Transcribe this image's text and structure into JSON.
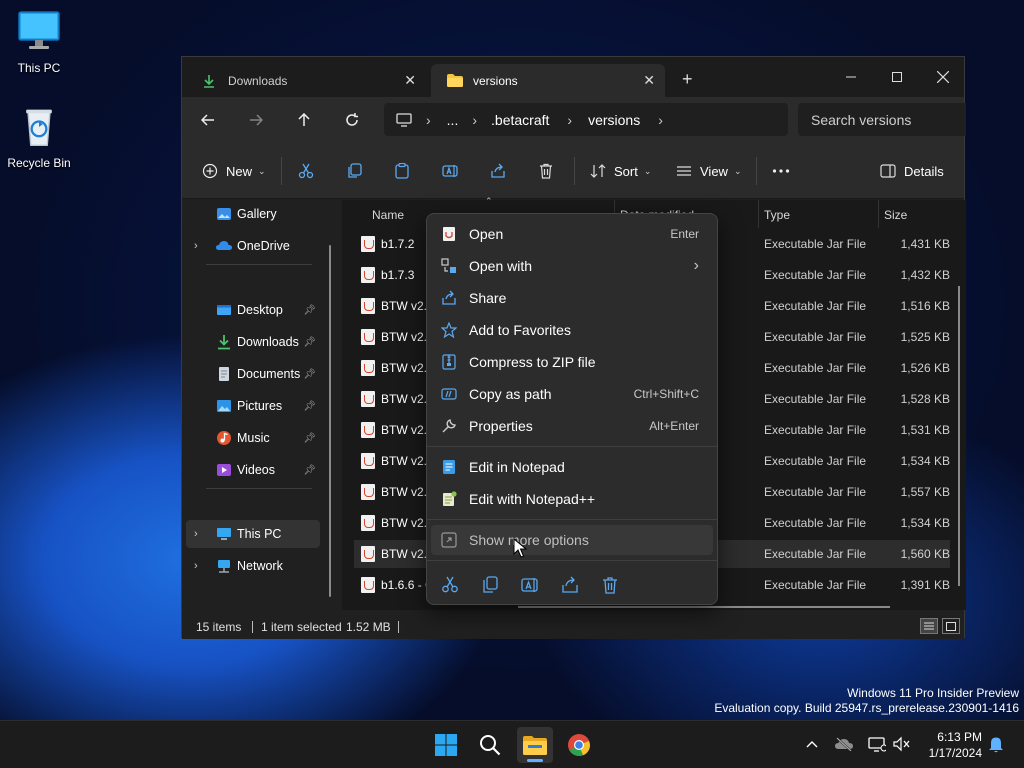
{
  "desktop": {
    "icons": [
      {
        "label": "This PC"
      },
      {
        "label": "Recycle Bin"
      }
    ]
  },
  "window": {
    "tabs": [
      {
        "label": "Downloads",
        "active": false
      },
      {
        "label": "versions",
        "active": true
      }
    ],
    "address": {
      "segments": [
        "...",
        ".betacraft",
        "versions"
      ],
      "search_placeholder": "Search versions"
    },
    "commandbar": {
      "new_label": "New",
      "sort_label": "Sort",
      "view_label": "View",
      "details_label": "Details"
    },
    "nav_pane": {
      "top_items": [
        {
          "label": "Gallery"
        },
        {
          "label": "OneDrive"
        }
      ],
      "quick_access": [
        {
          "label": "Desktop"
        },
        {
          "label": "Downloads"
        },
        {
          "label": "Documents"
        },
        {
          "label": "Pictures"
        },
        {
          "label": "Music"
        },
        {
          "label": "Videos"
        }
      ],
      "bottom_items": [
        {
          "label": "This PC",
          "selected": true
        },
        {
          "label": "Network"
        }
      ]
    },
    "columns": {
      "name": "Name",
      "date": "Date modified",
      "type": "Type",
      "size": "Size"
    },
    "files": [
      {
        "name": "b1.7.2",
        "type": "Executable Jar File",
        "size": "1,431 KB"
      },
      {
        "name": "b1.7.3",
        "type": "Executable Jar File",
        "size": "1,432 KB"
      },
      {
        "name": "BTW v2.3",
        "type": "Executable Jar File",
        "size": "1,516 KB"
      },
      {
        "name": "BTW v2.3",
        "type": "Executable Jar File",
        "size": "1,525 KB"
      },
      {
        "name": "BTW v2.4",
        "type": "Executable Jar File",
        "size": "1,526 KB"
      },
      {
        "name": "BTW v2.5",
        "type": "Executable Jar File",
        "size": "1,528 KB"
      },
      {
        "name": "BTW v2.5",
        "type": "Executable Jar File",
        "size": "1,531 KB"
      },
      {
        "name": "BTW v2.5",
        "type": "Executable Jar File",
        "size": "1,534 KB"
      },
      {
        "name": "BTW v2.6",
        "type": "Executable Jar File",
        "size": "1,557 KB"
      },
      {
        "name": "BTW v2.5",
        "type": "Executable Jar File",
        "size": "1,534 KB"
      },
      {
        "name": "BTW v2.6",
        "type": "Executable Jar File",
        "size": "1,560 KB",
        "selected": true
      },
      {
        "name": "b1.6.6 - C",
        "type": "Executable Jar File",
        "size": "1,391 KB"
      }
    ],
    "status": {
      "count": "15 items",
      "selection": "1 item selected",
      "size": "1.52 MB"
    }
  },
  "context_menu": {
    "items": [
      {
        "label": "Open",
        "shortcut": "Enter"
      },
      {
        "label": "Open with",
        "shortcut": "›"
      },
      {
        "label": "Share",
        "shortcut": ""
      },
      {
        "label": "Add to Favorites",
        "shortcut": ""
      },
      {
        "label": "Compress to ZIP file",
        "shortcut": ""
      },
      {
        "label": "Copy as path",
        "shortcut": "Ctrl+Shift+C"
      },
      {
        "label": "Properties",
        "shortcut": "Alt+Enter"
      },
      {
        "label": "Edit in Notepad",
        "shortcut": ""
      },
      {
        "label": "Edit with Notepad++",
        "shortcut": ""
      },
      {
        "label": "Show more options",
        "shortcut": ""
      }
    ]
  },
  "watermark": {
    "line1": "Windows 11 Pro Insider Preview",
    "line2": "Evaluation copy. Build 25947.rs_prerelease.230901-1416"
  },
  "taskbar": {
    "time": "6:13 PM",
    "date": "1/17/2024"
  },
  "colors": {
    "accent": "#5fb2ff",
    "window_bg": "#202020",
    "menu_bg": "#2c2c2c"
  }
}
